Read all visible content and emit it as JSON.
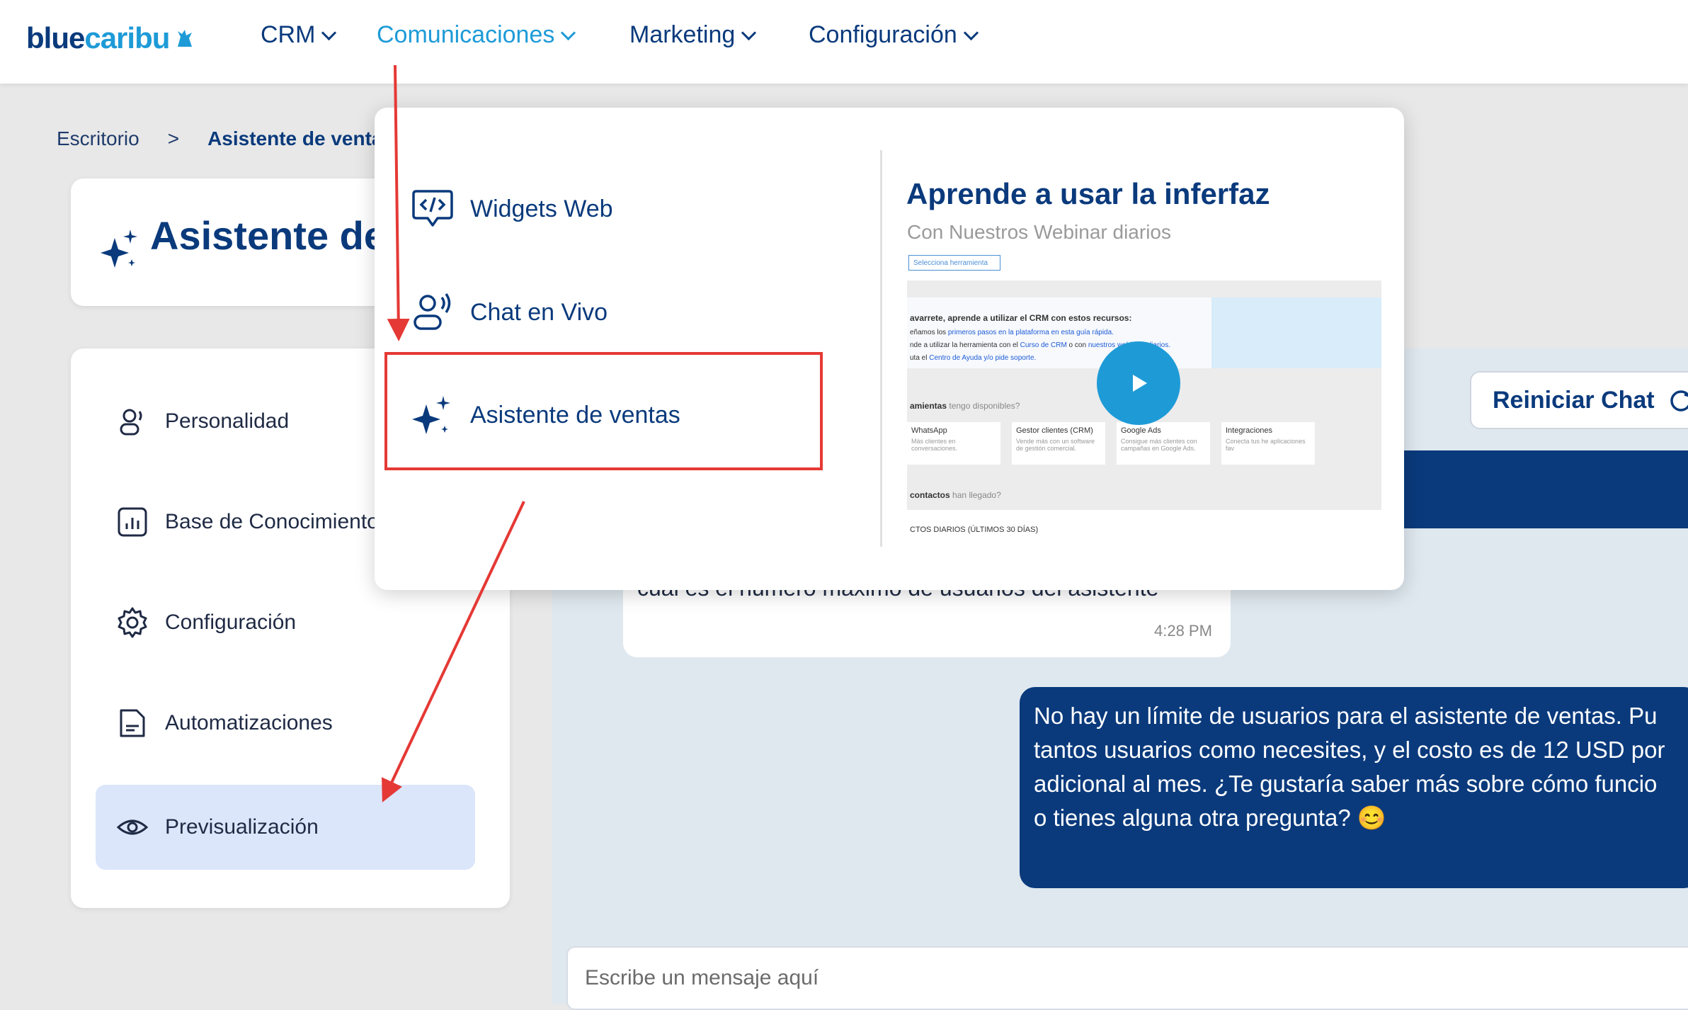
{
  "brand": {
    "logo_part1": "blue",
    "logo_part2": "caribu"
  },
  "nav": {
    "items": [
      {
        "label": "CRM"
      },
      {
        "label": "Comunicaciones"
      },
      {
        "label": "Marketing"
      },
      {
        "label": "Configuración"
      }
    ],
    "active": "Comunicaciones"
  },
  "breadcrumb": {
    "home": "Escritorio",
    "separator": ">",
    "current": "Asistente de ventas"
  },
  "page": {
    "title": "Asistente de ventas"
  },
  "sidebar": {
    "items": [
      {
        "label": "Personalidad",
        "icon": "user-voice-icon"
      },
      {
        "label": "Base de Conocimiento",
        "icon": "chart-icon"
      },
      {
        "label": "Configuración",
        "icon": "gear-icon"
      },
      {
        "label": "Automatizaciones",
        "icon": "document-icon"
      },
      {
        "label": "Previsualización",
        "icon": "eye-icon"
      }
    ],
    "active": "Previsualización"
  },
  "chat": {
    "reset_label": "Reiniciar Chat",
    "user_message": "cuál es el número máximo de usuarios del asistente",
    "user_time": "4:28 PM",
    "bot_message_lines": [
      "No hay un límite de usuarios para el asistente de ventas. Pu",
      "tantos usuarios como necesites, y el costo es de 12 USD por",
      "adicional al mes. ¿Te gustaría saber más sobre cómo funcio",
      "o tienes alguna otra pregunta? 😊"
    ],
    "composer_placeholder": "Escribe un mensaje aquí"
  },
  "dropdown": {
    "items": [
      {
        "label": "Widgets Web",
        "icon": "code-chat-icon"
      },
      {
        "label": "Chat en Vivo",
        "icon": "live-chat-icon"
      },
      {
        "label": "Asistente de ventas",
        "icon": "sparkle-icon"
      }
    ],
    "highlighted": "Asistente de ventas",
    "learn_title": "Aprende a usar la inferfaz",
    "learn_subtitle": "Con Nuestros Webinar diarios",
    "thumbnail": {
      "select_label": "Selecciona herramienta",
      "line1": "avarrete, aprende a utilizar el CRM con estos recursos:",
      "line2_a": "eñamos los ",
      "line2_b": "primeros pasos en la plataforma en esta guía rápida.",
      "line3_a": "nde a utilizar la herramienta con el ",
      "line3_b": "Curso de CRM",
      "line3_c": " o con ",
      "line3_d": "nuestros webinars diarios.",
      "line4_a": "uta el ",
      "line4_b": "Centro de Ayuda y/o pide soporte.",
      "tools_label": "amientas",
      "tools_suffix": "tengo disponibles?",
      "cards": [
        {
          "title": "WhatsApp",
          "desc": "Más clientes en conversaciones."
        },
        {
          "title": "Gestor clientes (CRM)",
          "desc": "Vende más con un software de gestión comercial."
        },
        {
          "title": "Google Ads",
          "desc": "Consigue más clientes con campañas en Google Ads."
        },
        {
          "title": "Integraciones",
          "desc": "Conecta tus he aplicaciones fav"
        }
      ],
      "contacts_label": "contactos",
      "contacts_suffix": "han llegado?",
      "daily_label": "CTOS DIARIOS (ÚLTIMOS 30 DÍAS)"
    }
  },
  "colors": {
    "brand_dark": "#0a3a7c",
    "brand_light": "#1e9bd7",
    "annotation": "#e53935"
  }
}
